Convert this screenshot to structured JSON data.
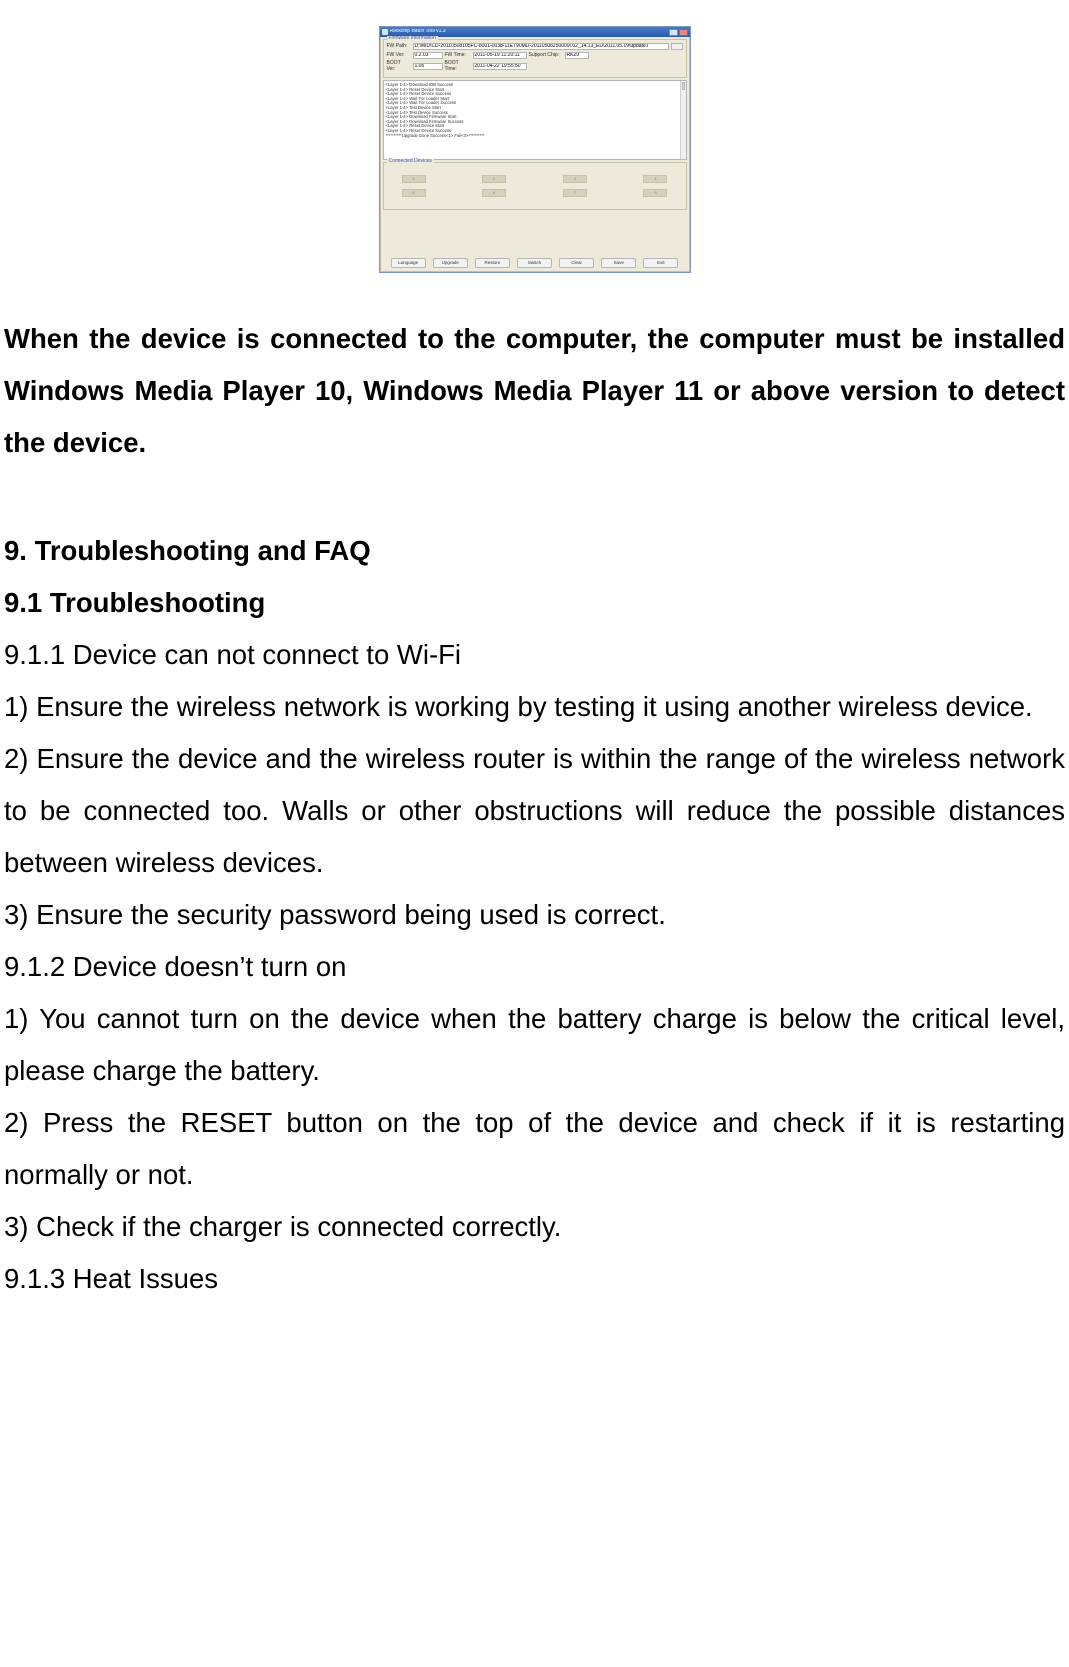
{
  "tool_window": {
    "title": "Rockchip Batch Tool v1.3",
    "firmware_group_label": "Firmware Information",
    "labels": {
      "fw_path": "FW Path:",
      "fw_ver": "FW Ver:",
      "fw_time": "FW Time:",
      "support_chip": "Support Chip:",
      "boot_ver": "BOOT Ver:",
      "boot_time": "BOOT Time:"
    },
    "values": {
      "fw_path": "D:\\MID\\CD-20110508105FC-8001-0038-11ET90MD-20110508250009\\.02_14.13_ED\\2011.05.19\\update.i",
      "fw_ver": "0.2.03",
      "fw_time": "2011-05-19 11:20:11",
      "support_chip": "RK29",
      "boot_ver": "1.05",
      "boot_time": "2011-04-22 19:55:50"
    },
    "log_lines": [
      "<Layer 1-4> Download IDB Success",
      "<Layer 1-4> Reset Device Start",
      "<Layer 1-4> Reset Device Success",
      "<Layer 1-4> Wait For Loader Start",
      "<Layer 1-4> Wait For Loader Success",
      "<Layer 1-4> Test Device Start",
      "<Layer 1-4> Test Device Success",
      "<Layer 1-4> Download Firmware Start",
      "<Layer 1-4> Download Firmware Success",
      "<Layer 1-4> Reset Device Start",
      "<Layer 1-4> Reset Device Success",
      "**********Upgrade Done Success<1> Fail<0>**********"
    ],
    "devices_label": "Connected Devices",
    "device_slots": [
      "1",
      "2",
      "3",
      "4",
      "5",
      "6",
      "7",
      "8"
    ],
    "buttons": [
      "Language",
      "Upgrade",
      "Restore",
      "Switch",
      "Clear",
      "Save",
      "Exit"
    ]
  },
  "doc": {
    "intro": "When the device is connected to the computer, the computer must be installed Windows Media Player 10, Windows Media Player 11 or above version to detect the device.",
    "h1": "9. Troubleshooting and FAQ",
    "h2": "9.1 Troubleshooting",
    "s911_title": "9.1.1 Device can not connect to Wi-Fi",
    "s911_1": "1) Ensure the wireless network is working by testing it using another wireless device.",
    "s911_2": "2) Ensure the device and the wireless router is within the range of the wireless network to be connected too. Walls or other obstructions will reduce the possible distances between wireless devices.",
    "s911_3": "3) Ensure the security password being used is correct.",
    "s912_title": "9.1.2 Device doesn’t turn on",
    "s912_1": "1) You cannot turn on the device when the battery charge is below the critical level, please charge the battery.",
    "s912_2": "2) Press the RESET button on the top of the device and check if it is restarting normally or not.",
    "s912_3": "3) Check if the charger is connected correctly.",
    "s913_title": "9.1.3 Heat Issues"
  }
}
